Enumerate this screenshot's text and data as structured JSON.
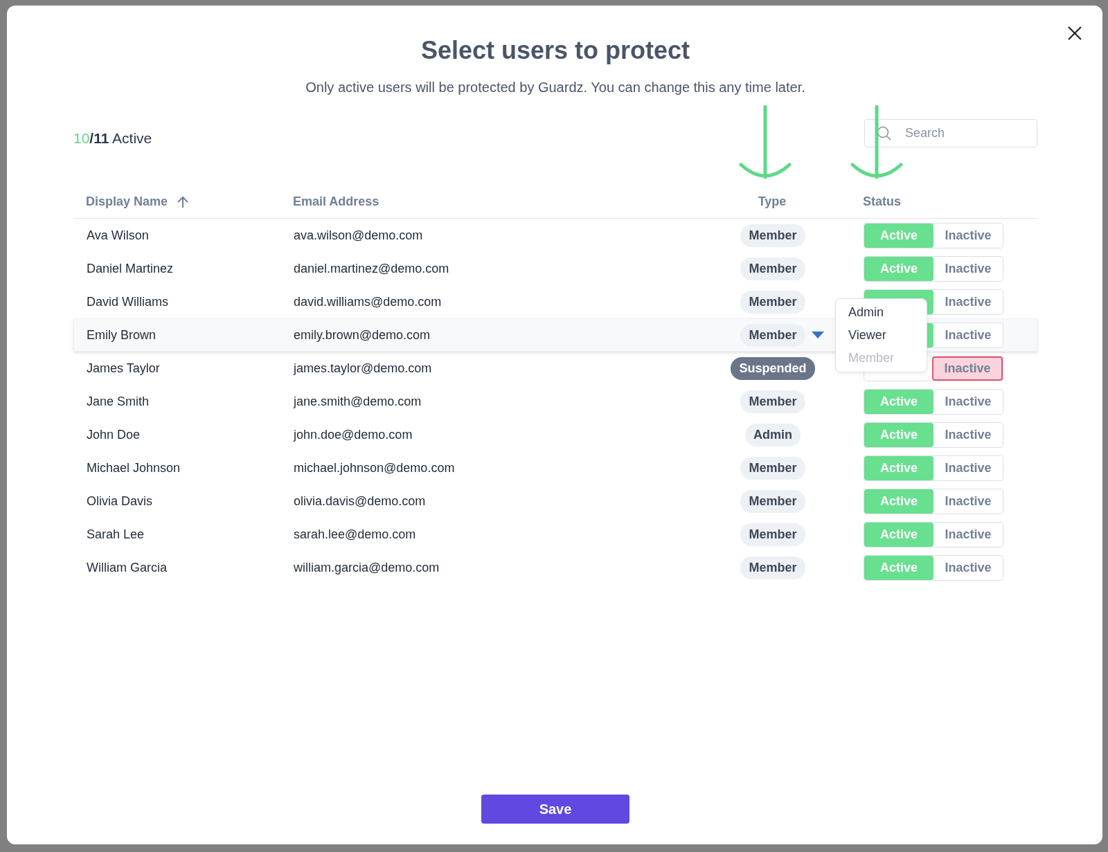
{
  "dialog": {
    "title": "Select users to protect",
    "subtitle": "Only active users will be protected by Guardz. You can change this any time later.",
    "counter": {
      "active": "10",
      "total": "/11",
      "label": "Active"
    },
    "search": {
      "placeholder": "Search"
    },
    "columns": [
      {
        "label": "Display Name",
        "sorted": true
      },
      {
        "label": "Email Address",
        "sorted": false
      },
      {
        "label": "Type",
        "sorted": false
      },
      {
        "label": "Status",
        "sorted": false
      }
    ],
    "rows": [
      {
        "name": "Ava Wilson",
        "email": "ava.wilson@demo.com",
        "type": {
          "label": "Member",
          "kind": "role"
        },
        "highlighted": false,
        "status": [
          {
            "label": "Active",
            "selected": true,
            "kind": "active"
          },
          {
            "label": "Inactive",
            "selected": false,
            "kind": "inactive"
          }
        ]
      },
      {
        "name": "Daniel Martinez",
        "email": "daniel.martinez@demo.com",
        "type": {
          "label": "Member",
          "kind": "role"
        },
        "highlighted": false,
        "status": [
          {
            "label": "Active",
            "selected": true,
            "kind": "active"
          },
          {
            "label": "Inactive",
            "selected": false,
            "kind": "inactive"
          }
        ]
      },
      {
        "name": "David Williams",
        "email": "david.williams@demo.com",
        "type": {
          "label": "Member",
          "kind": "role"
        },
        "highlighted": false,
        "status": [
          {
            "selected": true,
            "kind": "active"
          },
          {
            "label": "Inactive",
            "selected": false,
            "kind": "inactive"
          }
        ]
      },
      {
        "name": "Emily Brown",
        "email": "emily.brown@demo.com",
        "type": {
          "label": "Member",
          "kind": "role",
          "expanded": true,
          "menu": [
            {
              "label": "Admin",
              "disabled": false
            },
            {
              "label": "Viewer",
              "disabled": false
            },
            {
              "label": "Member",
              "disabled": true
            }
          ]
        },
        "highlighted": true,
        "status": [
          {
            "selected": true,
            "kind": "active"
          },
          {
            "label": "Inactive",
            "selected": false,
            "kind": "inactive"
          }
        ]
      },
      {
        "name": "James Taylor",
        "email": "james.taylor@demo.com",
        "type": {
          "label": "Suspended",
          "kind": "suspended"
        },
        "highlighted": false,
        "status": [
          {
            "selected": false,
            "kind": "active"
          },
          {
            "label": "Inactive",
            "selected": true,
            "kind": "inactive"
          }
        ]
      },
      {
        "name": "Jane Smith",
        "email": "jane.smith@demo.com",
        "type": {
          "label": "Member",
          "kind": "role"
        },
        "highlighted": false,
        "status": [
          {
            "label": "Active",
            "selected": true,
            "kind": "active"
          },
          {
            "label": "Inactive",
            "selected": false,
            "kind": "inactive"
          }
        ]
      },
      {
        "name": "John Doe",
        "email": "john.doe@demo.com",
        "type": {
          "label": "Admin",
          "kind": "role"
        },
        "highlighted": false,
        "status": [
          {
            "label": "Active",
            "selected": true,
            "kind": "active"
          },
          {
            "label": "Inactive",
            "selected": false,
            "kind": "inactive"
          }
        ]
      },
      {
        "name": "Michael Johnson",
        "email": "michael.johnson@demo.com",
        "type": {
          "label": "Member",
          "kind": "role"
        },
        "highlighted": false,
        "status": [
          {
            "label": "Active",
            "selected": true,
            "kind": "active"
          },
          {
            "label": "Inactive",
            "selected": false,
            "kind": "inactive"
          }
        ]
      },
      {
        "name": "Olivia Davis",
        "email": "olivia.davis@demo.com",
        "type": {
          "label": "Member",
          "kind": "role"
        },
        "highlighted": false,
        "status": [
          {
            "label": "Active",
            "selected": true,
            "kind": "active"
          },
          {
            "label": "Inactive",
            "selected": false,
            "kind": "inactive"
          }
        ]
      },
      {
        "name": "Sarah Lee",
        "email": "sarah.lee@demo.com",
        "type": {
          "label": "Member",
          "kind": "role"
        },
        "highlighted": false,
        "status": [
          {
            "label": "Active",
            "selected": true,
            "kind": "active"
          },
          {
            "label": "Inactive",
            "selected": false,
            "kind": "inactive"
          }
        ]
      },
      {
        "name": "William Garcia",
        "email": "william.garcia@demo.com",
        "type": {
          "label": "Member",
          "kind": "role"
        },
        "highlighted": false,
        "status": [
          {
            "label": "Active",
            "selected": true,
            "kind": "active"
          },
          {
            "label": "Inactive",
            "selected": false,
            "kind": "inactive"
          }
        ]
      }
    ],
    "save_button": "Save"
  }
}
